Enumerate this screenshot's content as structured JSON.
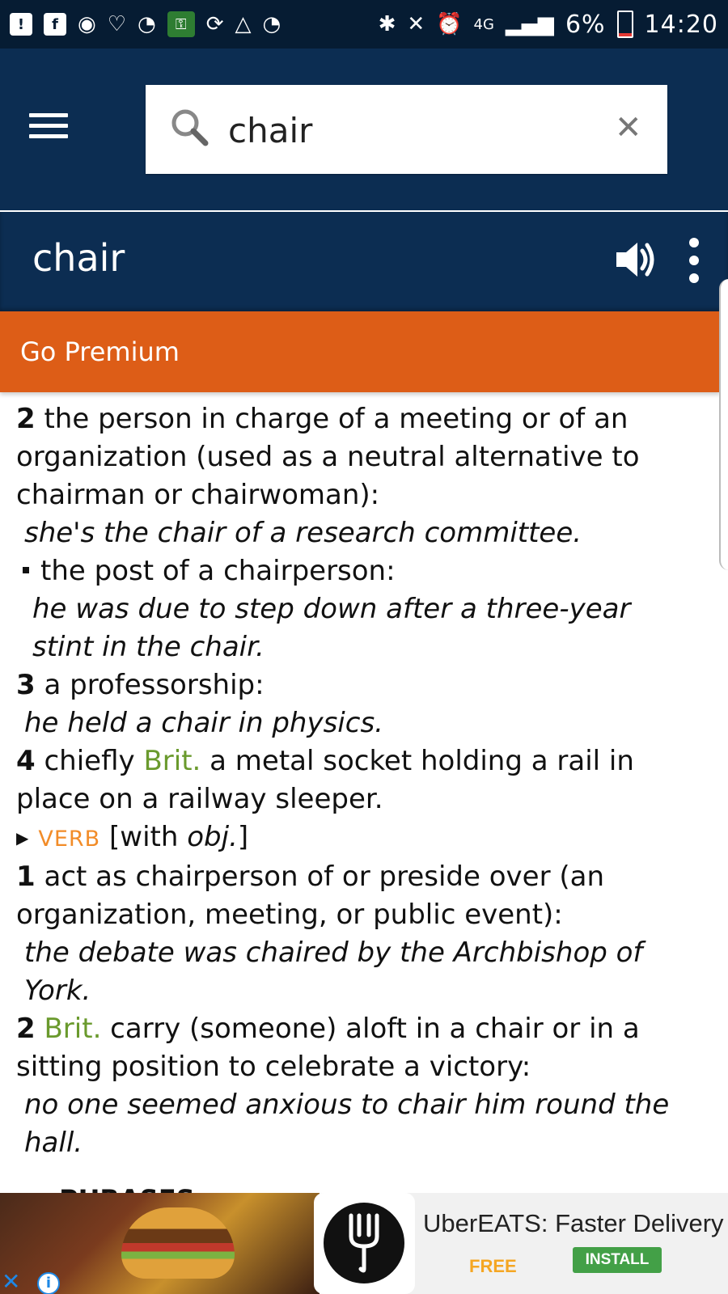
{
  "status_bar": {
    "network": "4G",
    "battery": "6%",
    "time": "14:20"
  },
  "search": {
    "value": "chair",
    "placeholder": ""
  },
  "entry": {
    "title": "chair"
  },
  "premium": {
    "label": "Go Premium"
  },
  "content": {
    "lines": [
      {
        "num": "2",
        "text": " the person in charge of a meeting or of an"
      },
      {
        "text": "organization (used as a neutral alternative to"
      },
      {
        "text": "chairman or chairwoman):"
      },
      {
        "example": "she's the chair of a research committee."
      },
      {
        "bullet_text": "the post of a chairperson:"
      },
      {
        "example": "he was due to step down after a three-year"
      },
      {
        "example": "stint in the chair."
      },
      {
        "num": "3",
        "text": " a professorship:"
      },
      {
        "example": "he held a chair in physics."
      },
      {
        "num": "4",
        "text": " chiefly ",
        "region": "Brit.",
        "text2": " a metal socket holding a rail in"
      },
      {
        "text": "place on a railway sleeper."
      },
      {
        "pos": "VERB",
        "grammar": " [with ",
        "grammar_italic": "obj.",
        "grammar_end": "]"
      },
      {
        "num": "1",
        "text": " act as chairperson of or preside over (an"
      },
      {
        "text": "organization, meeting, or public event):"
      },
      {
        "example": "the debate was chaired by the Archbishop of"
      },
      {
        "example": "York."
      },
      {
        "num": "2",
        "region": "Brit.",
        "text2": " carry (someone) aloft in a chair or in a"
      },
      {
        "text": "sitting position to celebrate a victory:"
      },
      {
        "example": "no one seemed anxious to chair him round the"
      },
      {
        "example": "hall."
      }
    ],
    "phrases_heading": "PHRASES"
  },
  "ad": {
    "title": "UberEATS: Faster Delivery",
    "price": "FREE",
    "install_label": "INSTALL"
  }
}
